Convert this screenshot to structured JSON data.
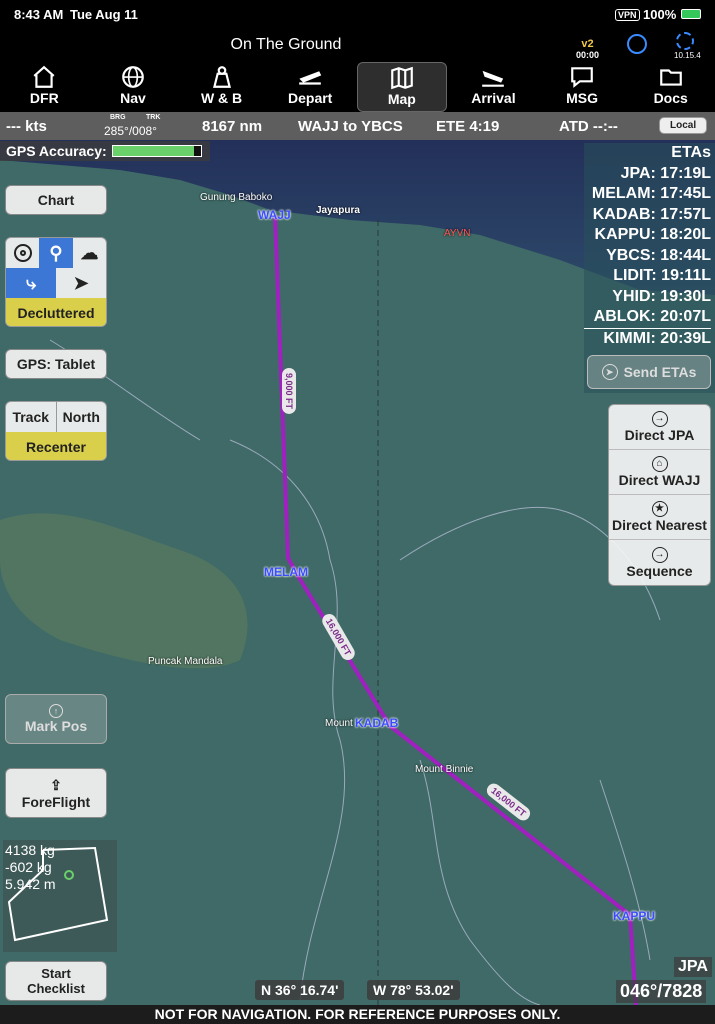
{
  "status": {
    "time": "8:43 AM",
    "date": "Tue Aug 11",
    "vpn": "VPN",
    "battery": "100%"
  },
  "title": "On The Ground",
  "version": {
    "tag": "v2",
    "time": "00:00",
    "build": "10.15.4"
  },
  "nav": [
    {
      "label": "DFR",
      "icon": "home-icon"
    },
    {
      "label": "Nav",
      "icon": "globe-icon"
    },
    {
      "label": "W & B",
      "icon": "weight-icon"
    },
    {
      "label": "Depart",
      "icon": "takeoff-icon"
    },
    {
      "label": "Map",
      "icon": "map-icon"
    },
    {
      "label": "Arrival",
      "icon": "landing-icon"
    },
    {
      "label": "MSG",
      "icon": "message-icon"
    },
    {
      "label": "Docs",
      "icon": "folder-icon"
    }
  ],
  "info": {
    "speed": "--- kts",
    "brg_label": "BRG",
    "trk_label": "TRK",
    "brg_trk": "285°/008°",
    "distance": "8167 nm",
    "route": "WAJJ to YBCS",
    "ete": "ETE 4:19",
    "atd": "ATD --:--",
    "local": "Local"
  },
  "gps": {
    "label": "GPS Accuracy:",
    "level": 0.92
  },
  "left": {
    "chart": "Chart",
    "decluttered": "Decluttered",
    "gps_tablet": "GPS: Tablet",
    "track": "Track",
    "north": "North",
    "recenter": "Recenter",
    "mark_pos": "Mark Pos",
    "foreflight": "ForeFlight",
    "start": "Start",
    "checklist": "Checklist"
  },
  "wb": {
    "line1": "4138 kg",
    "line2": "-602 kg",
    "line3": "5.942 m"
  },
  "etas": {
    "header": "ETAs",
    "items": [
      "JPA: 17:19L",
      "MELAM: 17:45L",
      "KADAB: 17:57L",
      "KAPPU: 18:20L",
      "YBCS: 18:44L",
      "LIDIT: 19:11L",
      "YHID: 19:30L",
      "ABLOK: 20:07L",
      "KIMMI: 20:39L"
    ],
    "send": "Send ETAs"
  },
  "direct": [
    {
      "label": "Direct JPA",
      "icon": "arrow-circle-icon"
    },
    {
      "label": "Direct WAJJ",
      "icon": "home-circle-icon"
    },
    {
      "label": "Direct Nearest",
      "icon": "star-circle-icon"
    },
    {
      "label": "Sequence",
      "icon": "arrow-circle-icon"
    }
  ],
  "map": {
    "waypoints": [
      "WAJJ",
      "MELAM",
      "KADAB",
      "KAPPU"
    ],
    "altitudes": [
      "9,000 FT",
      "16,000 FT",
      "16,000 FT"
    ],
    "places": [
      "Gunung Baboko",
      "Jayapura",
      "AYVN",
      "Puncak Mandala",
      "Mount Binnie",
      "Mount"
    ],
    "route_color": "#a020c0"
  },
  "bottom": {
    "lat": "N 36° 16.74'",
    "lon": "W 78° 53.02'",
    "dest": "JPA",
    "bearing": "046°/7828"
  },
  "footer": "NOT FOR NAVIGATION. FOR REFERENCE PURPOSES ONLY."
}
